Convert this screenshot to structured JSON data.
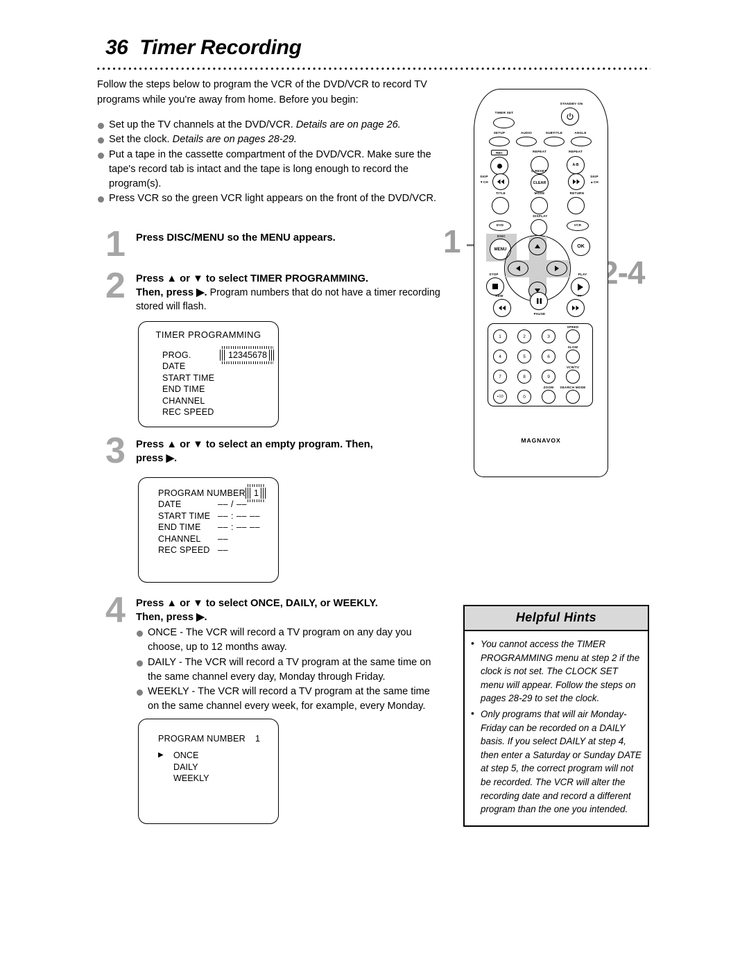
{
  "page": {
    "number": "36",
    "title": "Timer Recording"
  },
  "intro": {
    "paragraph": "Follow the steps below to program the VCR of the DVD/VCR to record TV programs while you're away from home. Before you begin:",
    "bullets": [
      {
        "text": "Set up the TV channels at the DVD/VCR. ",
        "italic": "Details are on page 26."
      },
      {
        "text": "Set the clock. ",
        "italic": "Details are on pages 28-29."
      },
      {
        "text": "Put a tape in the cassette compartment of the DVD/VCR. Make sure the tape's record tab is intact and the tape is long enough to record the program(s).",
        "italic": ""
      },
      {
        "text": "Press VCR so the green VCR light appears on the front of the DVD/VCR.",
        "italic": ""
      }
    ]
  },
  "steps": [
    {
      "number": "1",
      "heading": "Press DISC/MENU so the MENU appears.",
      "sub": ""
    },
    {
      "number": "2",
      "heading_a": "Press ▲ or ▼ to select TIMER PROGRAMMING.",
      "heading_b": "Then, press ▶.",
      "sub": " Program numbers that do not have a timer recording stored will flash."
    },
    {
      "number": "3",
      "heading_a": "Press ▲ or ▼ to select an empty program. Then,",
      "heading_b": "press ▶.",
      "sub": ""
    },
    {
      "number": "4",
      "heading_a": "Press ▲ or ▼ to select ONCE, DAILY, or WEEKLY.",
      "heading_b": "Then, press ▶.",
      "bullets": [
        "ONCE - The VCR will record a TV program on any day you choose, up to 12 months away.",
        "DAILY - The VCR will record a TV program at the same time on the same channel every day, Monday through Friday.",
        "WEEKLY - The VCR will record a TV program at the same time on the same channel every week, for example, every Monday."
      ]
    }
  ],
  "screens": [
    {
      "title": "TIMER PROGRAMMING",
      "rows": [
        {
          "label": "PROG.",
          "value": "12345678",
          "flashing": true
        },
        {
          "label": "DATE",
          "value": ""
        },
        {
          "label": "START TIME",
          "value": ""
        },
        {
          "label": "END TIME",
          "value": ""
        },
        {
          "label": "CHANNEL",
          "value": ""
        },
        {
          "label": "REC SPEED",
          "value": ""
        }
      ]
    },
    {
      "title": "",
      "rows": [
        {
          "label": "PROGRAM NUMBER",
          "value": "1",
          "flashing": true
        },
        {
          "label": "DATE",
          "value": "–– / ––"
        },
        {
          "label": "START TIME",
          "value": "–– : ––  ––"
        },
        {
          "label": "END   TIME",
          "value": "–– : ––  ––"
        },
        {
          "label": "CHANNEL",
          "value": "––"
        },
        {
          "label": "REC SPEED",
          "value": "––"
        }
      ]
    },
    {
      "title": "",
      "header_label": "PROGRAM NUMBER",
      "header_value": "1",
      "options": [
        "ONCE",
        "DAILY",
        "WEEKLY"
      ],
      "selected": "ONCE",
      "cursor": "▶"
    }
  ],
  "hints": {
    "header": "Helpful Hints",
    "items": [
      "You cannot access the TIMER PROGRAMMING menu at step 2 if the clock is not set. The CLOCK SET menu will appear. Follow the steps on pages 28-29 to set the clock.",
      "Only programs that will air Monday-Friday can be recorded on a DAILY basis. If you select DAILY at step 4, then enter a Saturday or Sunday DATE at step 5, the correct program will not be recorded. The VCR will alter the recording date and record a different program than the one you intended."
    ]
  },
  "remote": {
    "brand": "MAGNAVOX",
    "labels": {
      "timer_set": "TIMER SET",
      "standby_on": "STANDBY·ON",
      "setup": "SETUP",
      "audio": "AUDIO",
      "subtitle": "SUBTITLE",
      "angle": "ANGLE",
      "rec": "REC",
      "repeat": "REPEAT",
      "repeat_ab": "REPEAT",
      "ab": "A-B",
      "c_reset": "C-RESET",
      "clear": "CLEAR",
      "skip_down": "SKIP",
      "skip_down2": "▼CH",
      "skip_up": "SKIP",
      "skip_up2": "▲CH",
      "title": "TITLE",
      "mode": "MODE",
      "return": "RETURN",
      "display": "DISPLAY",
      "dvd": "DVD",
      "vcr": "VCR",
      "disc": "DISC",
      "menu": "MENU",
      "ok": "OK",
      "stop": "STOP",
      "play": "PLAY",
      "rew": "REW",
      "pause": "PAUSE",
      "ff": "FF",
      "speed": "SPEED",
      "slow": "SLOW",
      "vcrtv": "VCR/TV",
      "zoom": "ZOOM",
      "search_mode": "SEARCH MODE"
    },
    "keypad": [
      "1",
      "2",
      "3",
      "4",
      "5",
      "6",
      "7",
      "8",
      "9",
      "+10",
      "0"
    ]
  },
  "callouts": {
    "first": "1",
    "second": "2-4"
  }
}
